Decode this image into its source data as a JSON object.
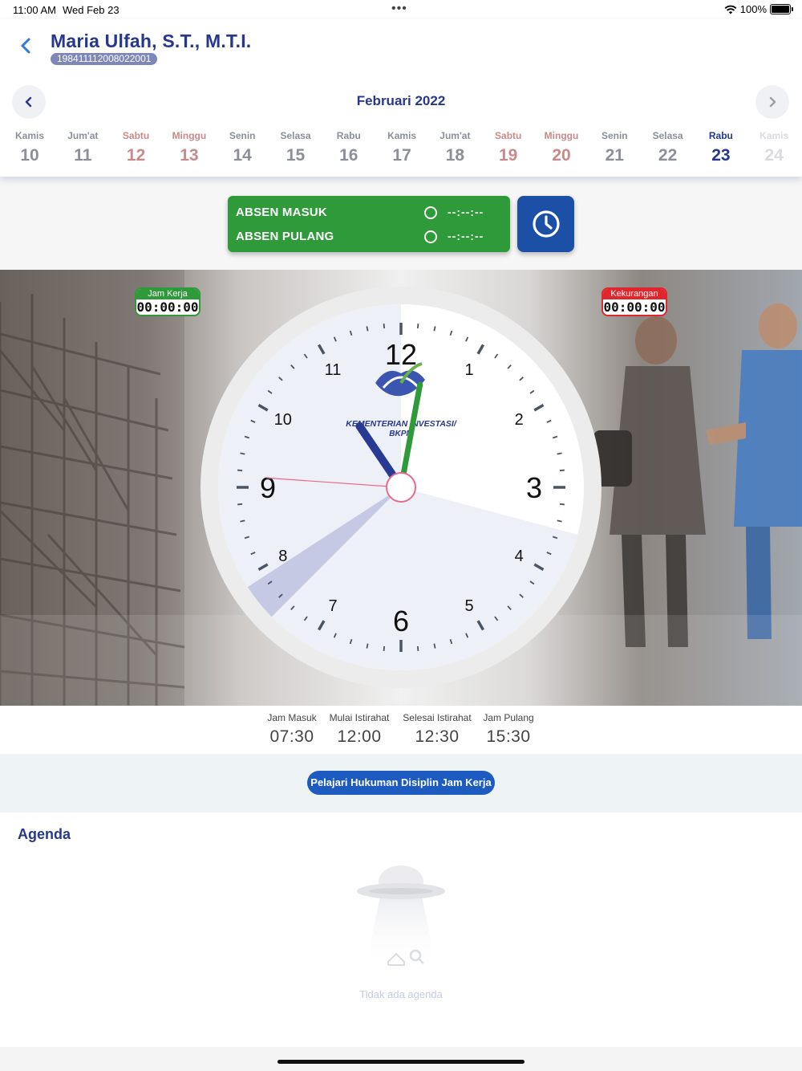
{
  "status_bar": {
    "time": "11:00 AM",
    "date": "Wed Feb 23",
    "battery": "100%"
  },
  "header": {
    "name": "Maria Ulfah, S.T., M.T.I.",
    "nip": "198411112008022001"
  },
  "calendar": {
    "month": "Februari 2022",
    "days": [
      {
        "name": "Kamis",
        "num": "10",
        "state": "normal"
      },
      {
        "name": "Jum'at",
        "num": "11",
        "state": "normal"
      },
      {
        "name": "Sabtu",
        "num": "12",
        "state": "weekend"
      },
      {
        "name": "Minggu",
        "num": "13",
        "state": "weekend"
      },
      {
        "name": "Senin",
        "num": "14",
        "state": "normal"
      },
      {
        "name": "Selasa",
        "num": "15",
        "state": "normal"
      },
      {
        "name": "Rabu",
        "num": "16",
        "state": "normal"
      },
      {
        "name": "Kamis",
        "num": "17",
        "state": "normal"
      },
      {
        "name": "Jum'at",
        "num": "18",
        "state": "normal"
      },
      {
        "name": "Sabtu",
        "num": "19",
        "state": "weekend"
      },
      {
        "name": "Minggu",
        "num": "20",
        "state": "weekend"
      },
      {
        "name": "Senin",
        "num": "21",
        "state": "normal"
      },
      {
        "name": "Selasa",
        "num": "22",
        "state": "normal"
      },
      {
        "name": "Rabu",
        "num": "23",
        "state": "active"
      },
      {
        "name": "Kamis",
        "num": "24",
        "state": "future"
      }
    ]
  },
  "attendance": {
    "masuk_label": "ABSEN MASUK",
    "masuk_value": "--:--:--",
    "pulang_label": "ABSEN PULANG",
    "pulang_value": "--:--:--"
  },
  "badges": {
    "jam_kerja_label": "Jam Kerja",
    "jam_kerja_value": "00:00:00",
    "kekurangan_label": "Kekurangan",
    "kekurangan_value": "00:00:00"
  },
  "clock": {
    "time": {
      "hour": 11,
      "minute": 1,
      "second": 45
    },
    "numbers": [
      "12",
      "1",
      "2",
      "3",
      "4",
      "5",
      "6",
      "7",
      "8",
      "9",
      "10",
      "11"
    ],
    "logo_text_1": "KEMENTERIAN INVESTASI/",
    "logo_text_2": "BKPM",
    "colors": {
      "hour_hand": "#273a94",
      "minute_hand": "#2f9a3a",
      "second_hand": "#e8698c",
      "work_sector": "#eef0f7",
      "late_sector": "#c5c9e4"
    }
  },
  "schedule": [
    {
      "label": "Jam Masuk",
      "value": "07:30"
    },
    {
      "label": "Mulai Istirahat",
      "value": "12:00"
    },
    {
      "label": "Selesai Istirahat",
      "value": "12:30"
    },
    {
      "label": "Jam Pulang",
      "value": "15:30"
    }
  ],
  "hukuman_button": "Pelajari Hukuman Disiplin Jam Kerja",
  "agenda": {
    "title": "Agenda",
    "empty_text": "Tidak ada agenda"
  }
}
